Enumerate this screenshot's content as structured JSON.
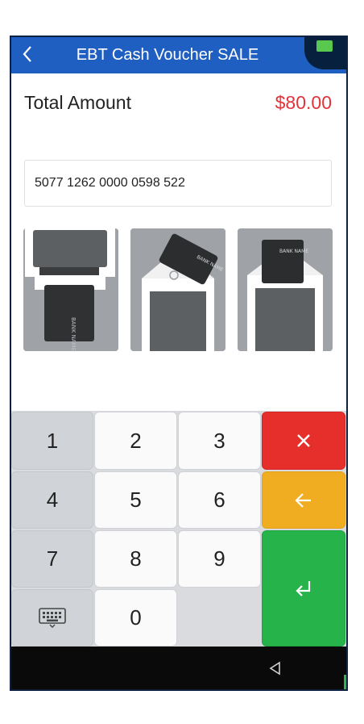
{
  "header": {
    "title": "EBT Cash Voucher SALE",
    "back_icon": "chevron-left-icon",
    "battery_icon": "battery-icon",
    "color": "#1f5fc1"
  },
  "amount": {
    "label": "Total Amount",
    "value": "$80.00",
    "value_color": "#e0343a"
  },
  "card_input": {
    "value": "5077 1262 0000 0598 522"
  },
  "card_methods": [
    {
      "name": "swipe",
      "icon": "card-swipe-icon",
      "card_text": "BANK NAME"
    },
    {
      "name": "tap",
      "icon": "card-tap-icon",
      "card_text": "BANK NAME"
    },
    {
      "name": "insert",
      "icon": "card-insert-icon",
      "card_text": "BANK NAME"
    }
  ],
  "keypad": {
    "digits": [
      "1",
      "2",
      "3",
      "4",
      "5",
      "6",
      "7",
      "8",
      "9",
      "0"
    ],
    "clear_icon": "close-icon",
    "clear_color": "#e62e2b",
    "backspace_icon": "arrow-left-icon",
    "backspace_color": "#f1ad21",
    "enter_icon": "enter-icon",
    "enter_color": "#26b34a",
    "keyboard_icon": "keyboard-icon"
  },
  "navbar": {
    "back_icon": "nav-back-triangle-icon"
  }
}
